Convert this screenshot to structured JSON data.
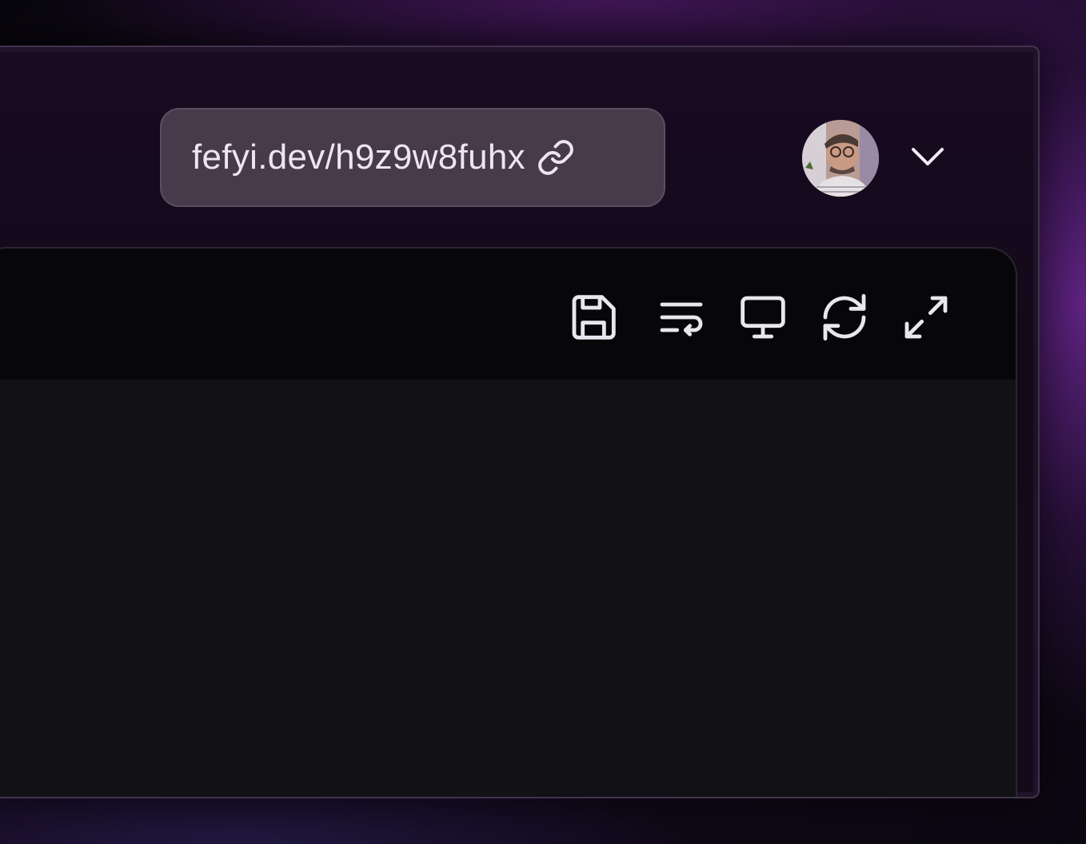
{
  "share": {
    "url_text": "fefyi.dev/h9z9w8fuhx",
    "icon": "link-icon"
  },
  "user": {
    "avatar": "avatar",
    "menu_icon": "chevron-down-icon"
  },
  "toolbar": {
    "tools": [
      {
        "name": "save",
        "icon": "save-icon"
      },
      {
        "name": "word-wrap",
        "icon": "wrap-text-icon"
      },
      {
        "name": "preview",
        "icon": "monitor-icon"
      },
      {
        "name": "refresh",
        "icon": "refresh-icon"
      },
      {
        "name": "fullscreen",
        "icon": "maximize-icon"
      }
    ]
  },
  "colors": {
    "pill_bg": "#463a4b",
    "toolbar_bg": "#070709",
    "editor_bg": "#121115",
    "icon_stroke": "#eae6ee"
  }
}
